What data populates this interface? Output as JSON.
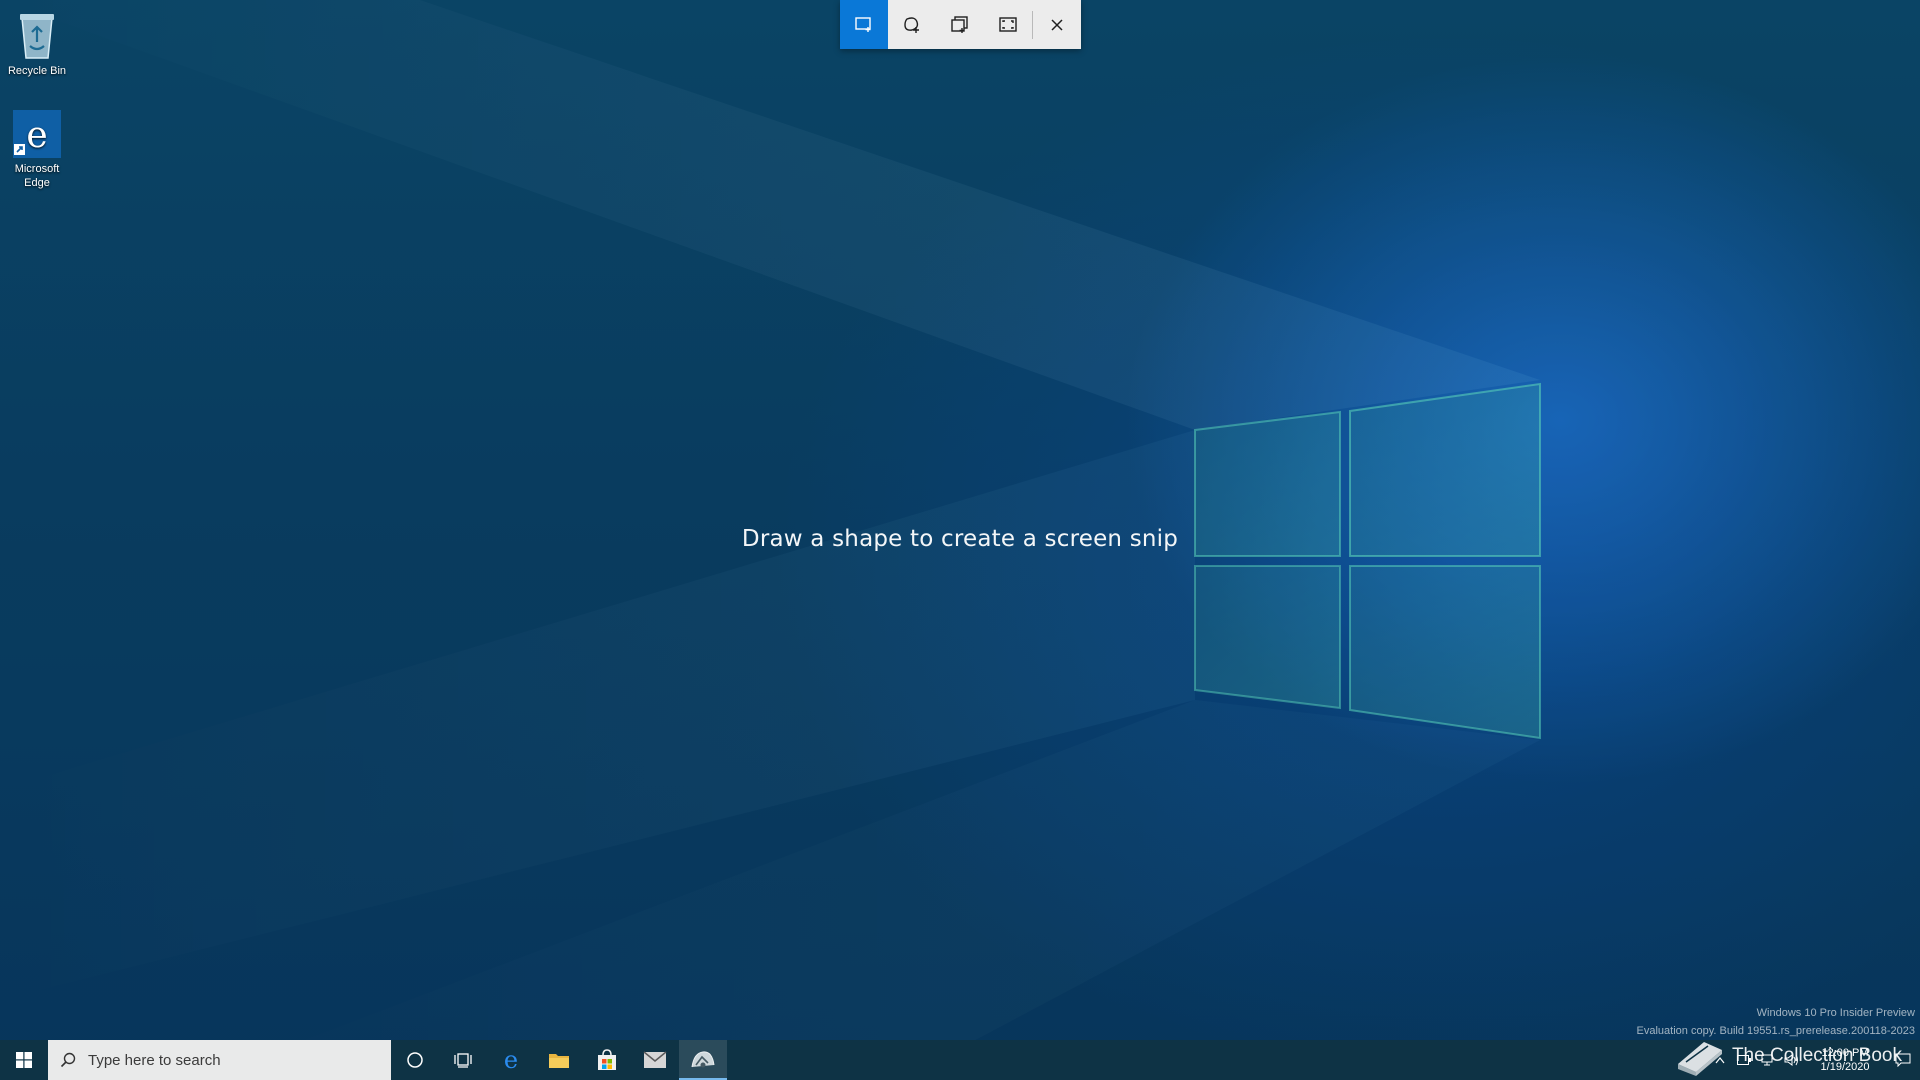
{
  "desktop": {
    "icons": [
      {
        "label": "Recycle Bin",
        "icon": "recycle-bin-icon"
      },
      {
        "label": "Microsoft Edge",
        "icon": "edge-icon"
      }
    ]
  },
  "snip_toolbar": {
    "modes": [
      {
        "name": "rectangular-snip",
        "icon": "rectangle-snip-icon",
        "active": true
      },
      {
        "name": "freeform-snip",
        "icon": "freeform-snip-icon",
        "active": false
      },
      {
        "name": "window-snip",
        "icon": "window-snip-icon",
        "active": false
      },
      {
        "name": "fullscreen-snip",
        "icon": "fullscreen-snip-icon",
        "active": false
      }
    ],
    "close_icon": "close-icon",
    "active_color": "#0a78d7"
  },
  "hint": "Draw a shape to create a screen snip",
  "watermark": {
    "line1": "Windows 10 Pro Insider Preview",
    "line2": "Evaluation copy. Build 19551.rs_prerelease.200118-2023"
  },
  "taskbar": {
    "search_placeholder": "Type here to search",
    "apps": [
      "cortana-icon",
      "task-view-icon",
      "edge-icon",
      "file-explorer-icon",
      "store-icon",
      "mail-icon",
      "snip-sketch-icon"
    ],
    "active_app": "snip-sketch-icon",
    "clock_time": "12:00 PM",
    "clock_date": "1/19/2020"
  },
  "overlay_brand": "The Collection Book"
}
